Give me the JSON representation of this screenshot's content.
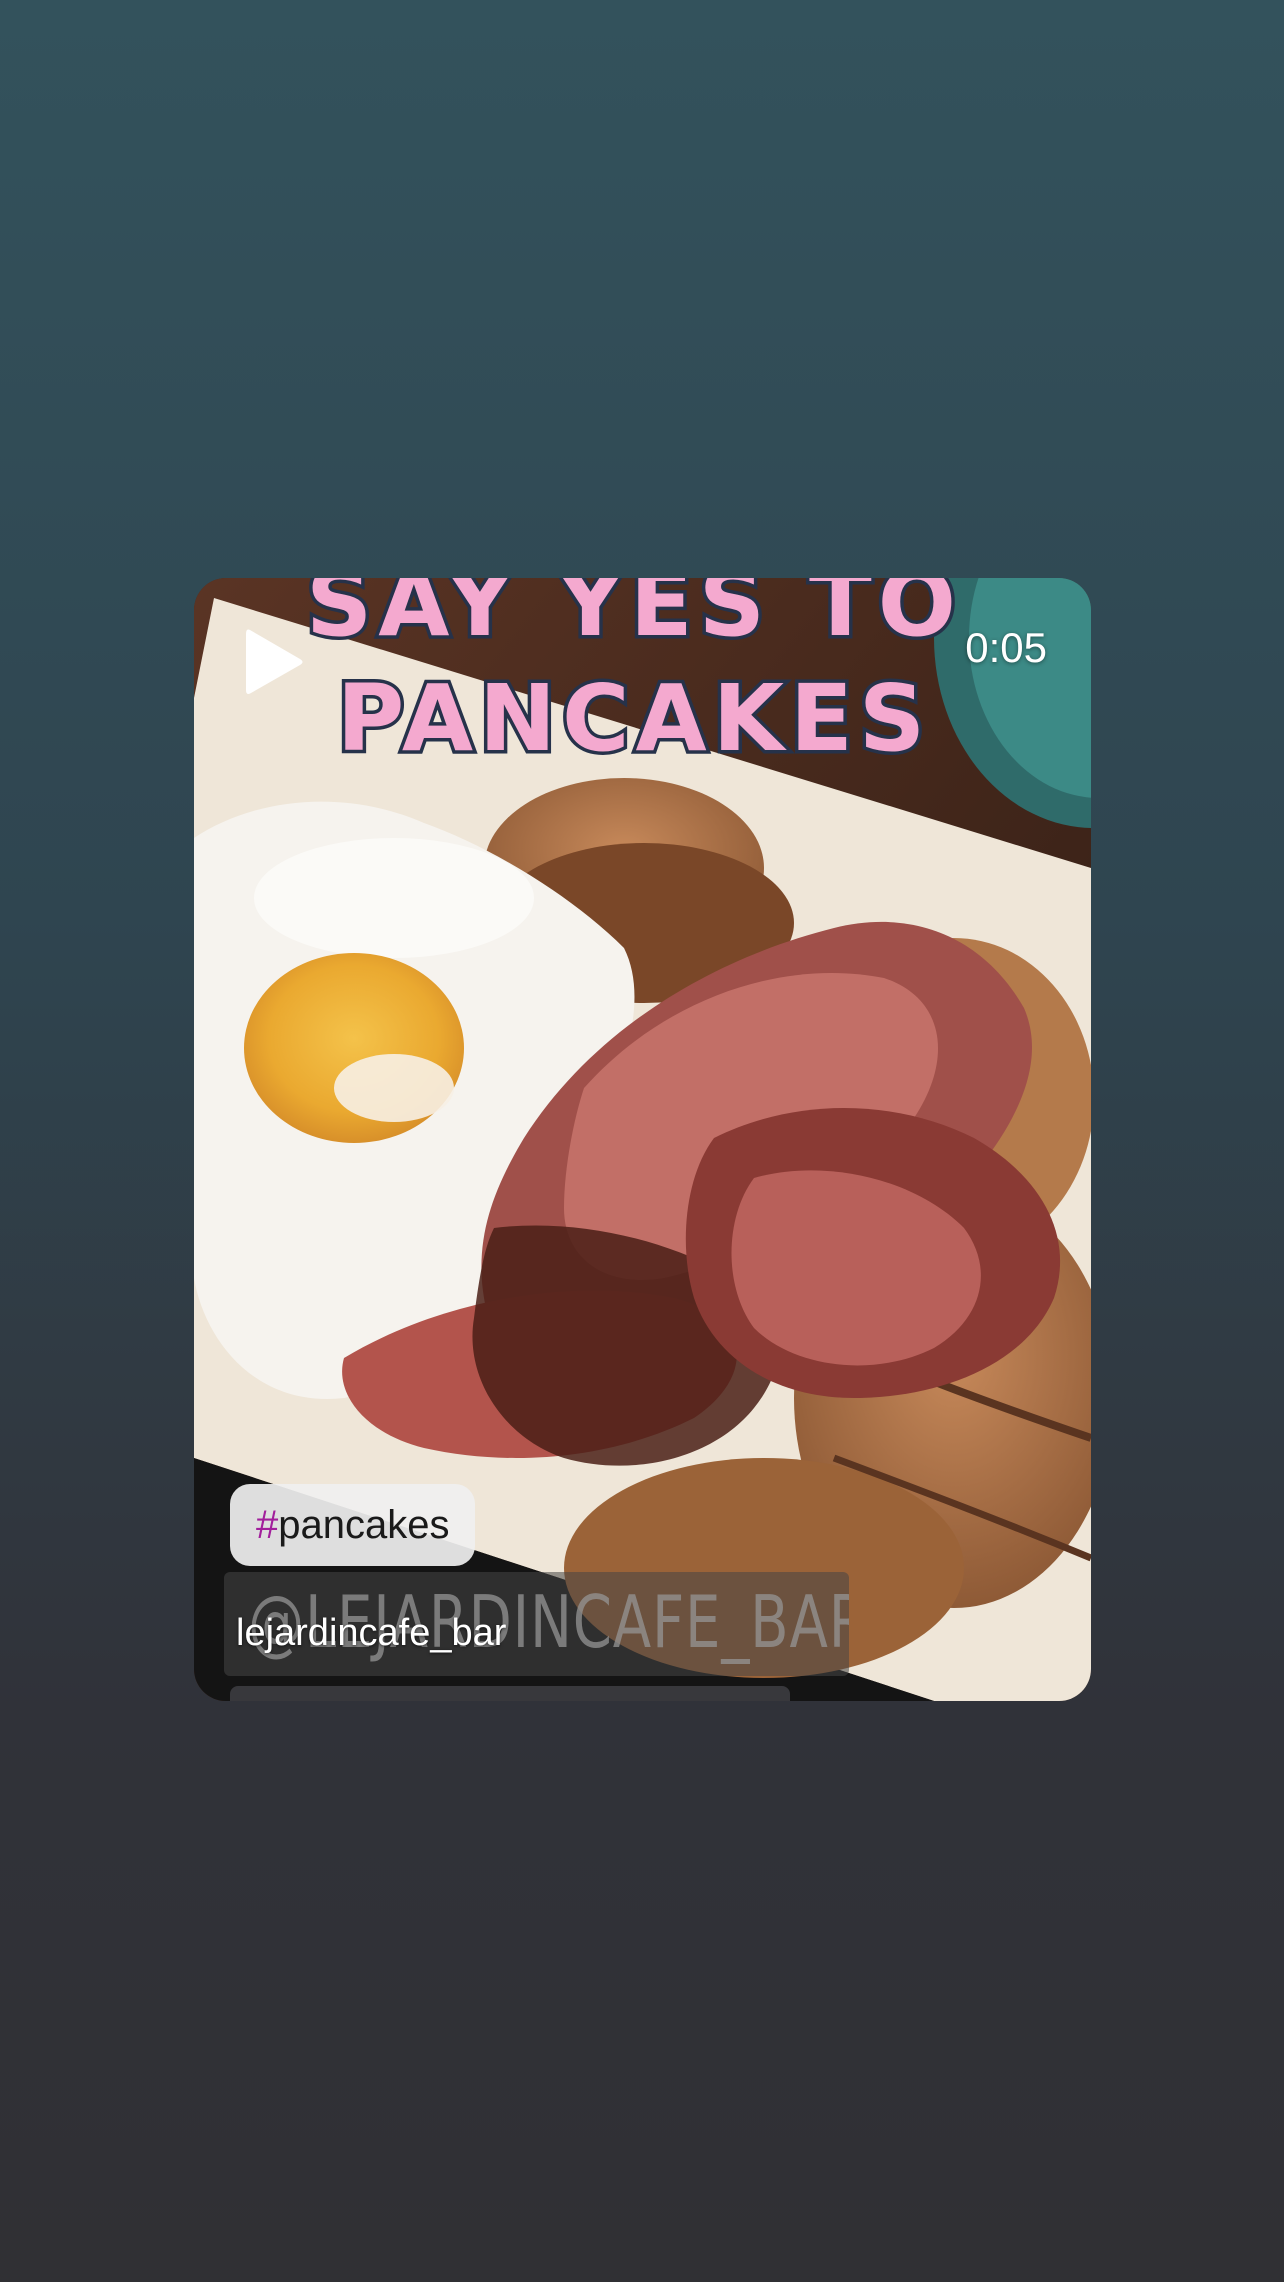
{
  "video": {
    "duration": "0:05",
    "headline_line1": "SAY YES TO",
    "headline_line2": "PANCAKES",
    "hashtag_symbol": "#",
    "hashtag_text": "pancakes",
    "mention_sticker": "@LEJARDINCAFE_BAR",
    "username": "lejardincafe_bar",
    "controls": {
      "play_icon": "play-icon"
    },
    "colors": {
      "headline_fill": "#f4a9cf",
      "headline_stroke": "#26324a",
      "hashtag_accent": "#a21f9c"
    }
  }
}
